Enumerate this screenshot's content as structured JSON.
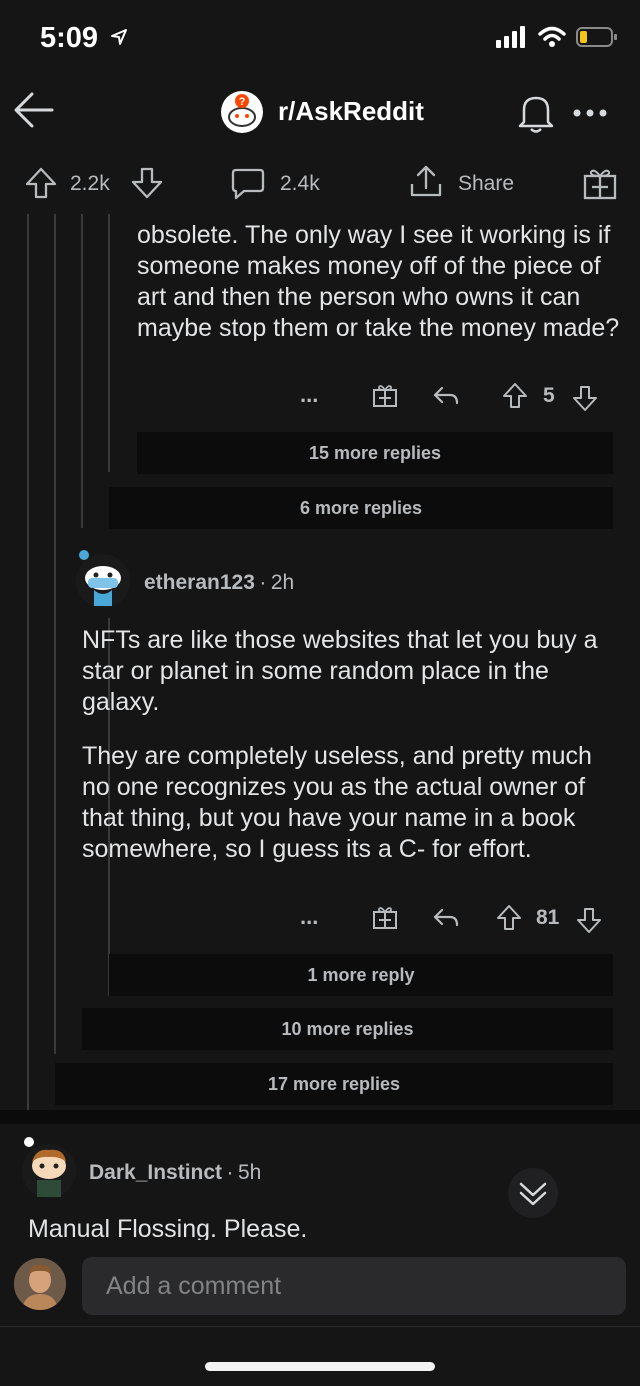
{
  "status": {
    "time": "5:09"
  },
  "header": {
    "subreddit": "r/AskReddit"
  },
  "actions": {
    "upvotes": "2.2k",
    "comments": "2.4k",
    "share": "Share"
  },
  "comment1": {
    "text": "obsolete. The only way I see it working is if someone makes money off of the piece of art and then the person who owns it can maybe stop them or take the money made?",
    "ellipsis": "...",
    "votes": "5"
  },
  "more_replies": {
    "a": "15 more replies",
    "b": "6 more replies",
    "c": "1 more reply",
    "d": "10 more replies",
    "e": "17 more replies"
  },
  "comment2": {
    "user": "etheran123",
    "age": "2h",
    "p1": "NFTs are like those websites that let you buy a star or planet in some random place in the galaxy.",
    "p2": "They are completely useless, and pretty much no one recognizes you as the actual owner of that thing, but you have your name in a book somewhere, so I guess its a C- for effort.",
    "ellipsis": "...",
    "votes": "81"
  },
  "comment3": {
    "user": "Dark_Instinct",
    "age": "5h",
    "text": "Manual Flossing. Please."
  },
  "composer": {
    "placeholder": "Add a comment"
  },
  "dot": "·"
}
